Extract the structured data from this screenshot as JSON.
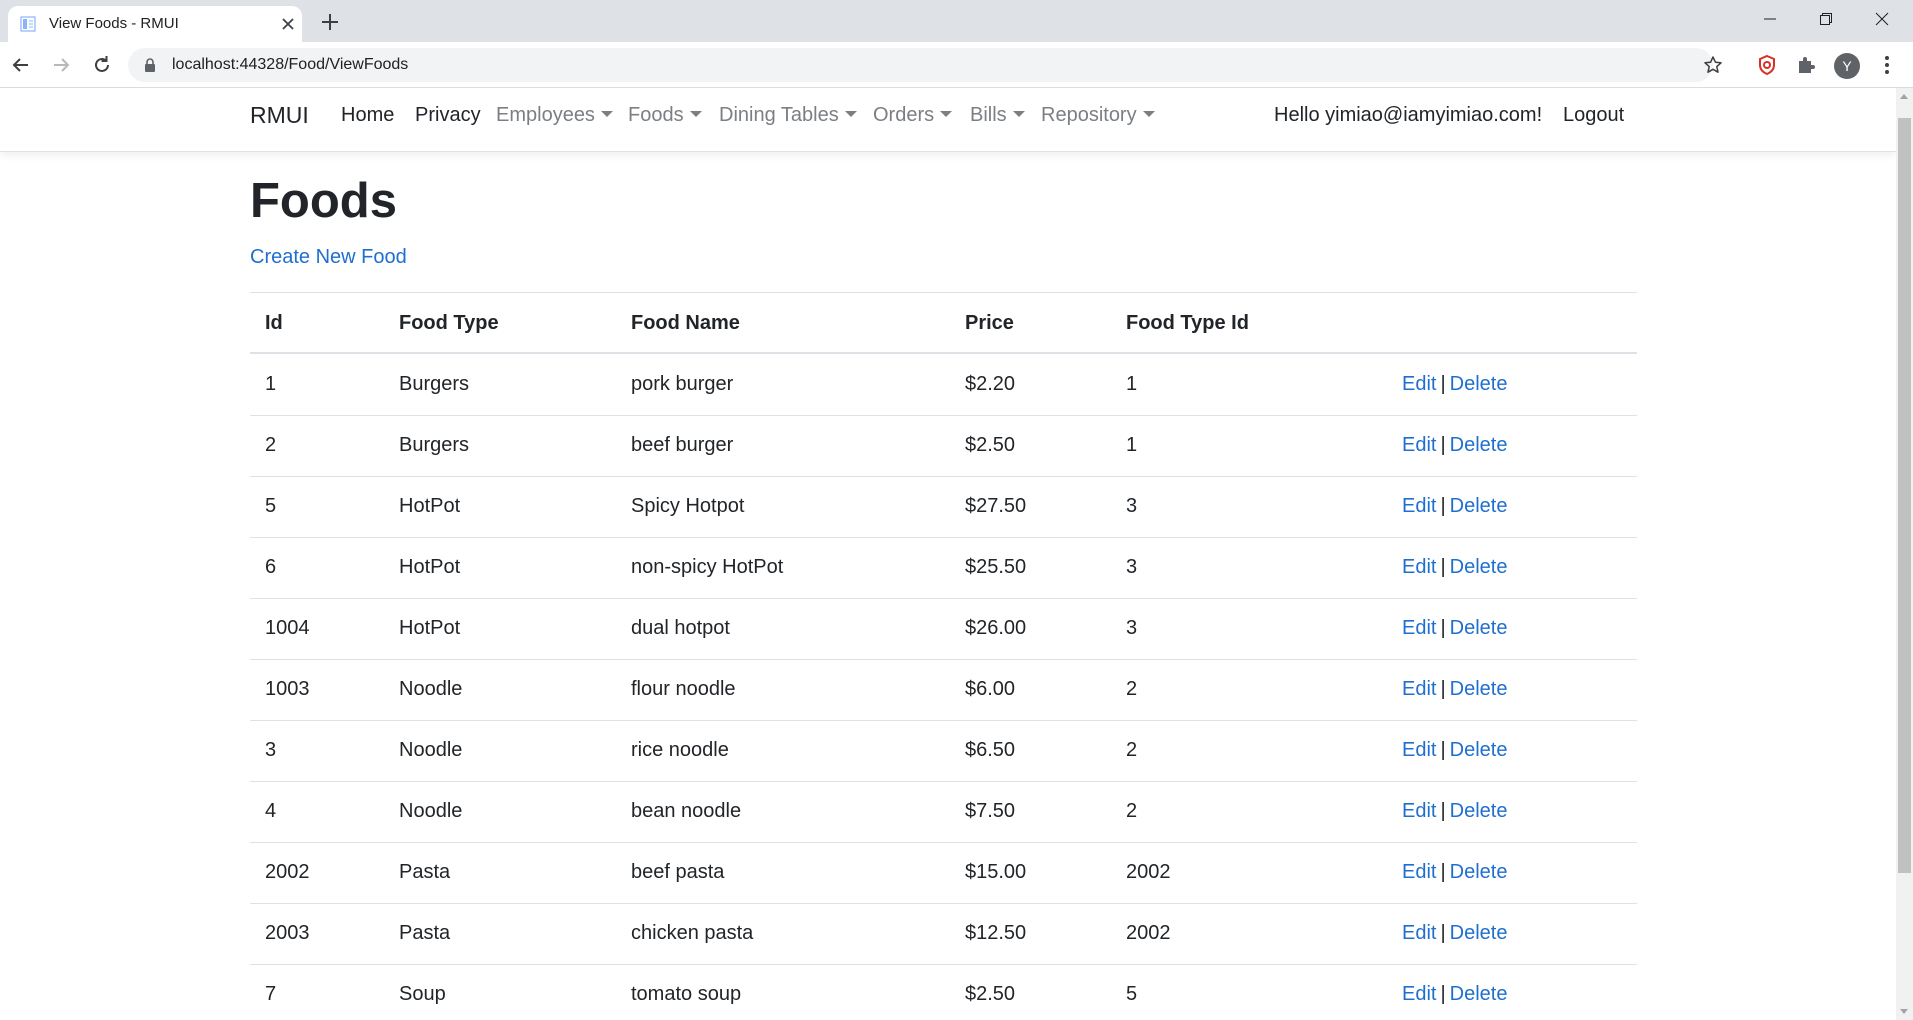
{
  "browser": {
    "tab_title": "View Foods - RMUI",
    "url": "localhost:44328/Food/ViewFoods",
    "profile_initial": "Y"
  },
  "site": {
    "brand": "RMUI",
    "nav": {
      "home": "Home",
      "privacy": "Privacy",
      "employees": "Employees",
      "foods": "Foods",
      "dining_tables": "Dining Tables",
      "orders": "Orders",
      "bills": "Bills",
      "repository": "Repository"
    },
    "greeting": "Hello yimiao@iamyimiao.com!",
    "logout": "Logout"
  },
  "page": {
    "title": "Foods",
    "create_link": "Create New Food"
  },
  "table": {
    "headers": [
      "Id",
      "Food Type",
      "Food Name",
      "Price",
      "Food Type Id"
    ],
    "action_edit": "Edit",
    "action_separator": "|",
    "action_delete": "Delete",
    "rows": [
      [
        "1",
        "Burgers",
        "pork burger",
        "$2.20",
        "1"
      ],
      [
        "2",
        "Burgers",
        "beef burger",
        "$2.50",
        "1"
      ],
      [
        "5",
        "HotPot",
        "Spicy Hotpot",
        "$27.50",
        "3"
      ],
      [
        "6",
        "HotPot",
        "non-spicy HotPot",
        "$25.50",
        "3"
      ],
      [
        "1004",
        "HotPot",
        "dual hotpot",
        "$26.00",
        "3"
      ],
      [
        "1003",
        "Noodle",
        "flour noodle",
        "$6.00",
        "2"
      ],
      [
        "3",
        "Noodle",
        "rice noodle",
        "$6.50",
        "2"
      ],
      [
        "4",
        "Noodle",
        "bean noodle",
        "$7.50",
        "2"
      ],
      [
        "2002",
        "Pasta",
        "beef pasta",
        "$15.00",
        "2002"
      ],
      [
        "2003",
        "Pasta",
        "chicken pasta",
        "$12.50",
        "2002"
      ],
      [
        "7",
        "Soup",
        "tomato soup",
        "$2.50",
        "5"
      ]
    ]
  },
  "colors": {
    "link": "#1f6fd0",
    "text": "#212529",
    "muted_nav": "#7b7f84",
    "border": "#dee2e6",
    "chrome_tabstrip": "#dee1e6",
    "extension_red": "#d93025"
  }
}
